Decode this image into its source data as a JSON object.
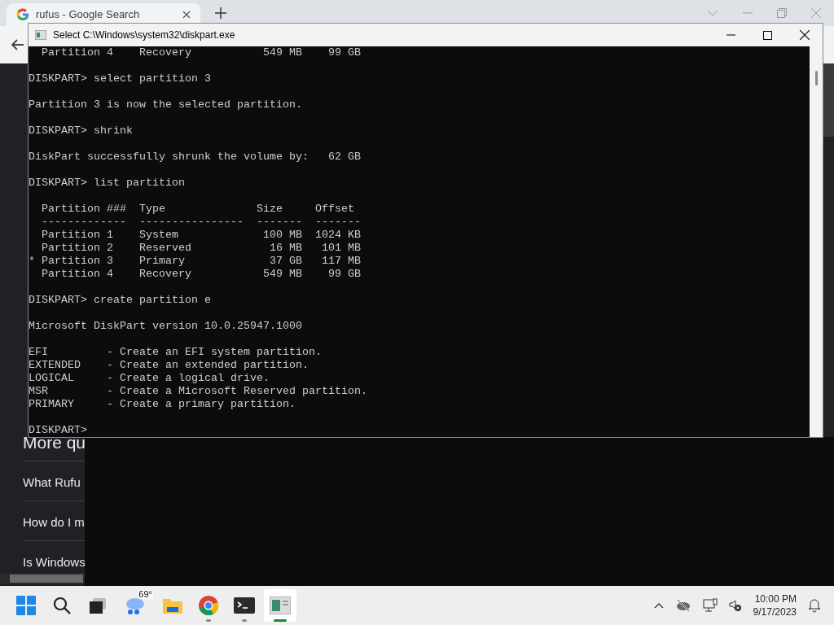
{
  "browser": {
    "tab": {
      "title": "rufus - Google Search",
      "selected": true
    },
    "more_questions": {
      "heading": "More qu",
      "items": [
        "What Rufu",
        "How do I m",
        "Is Windows"
      ]
    }
  },
  "console": {
    "title": "Select C:\\Windows\\system32\\diskpart.exe",
    "blocks": [
      [
        "  Partition 4    Recovery           549 MB    99 GB"
      ],
      [
        "DISKPART> select partition 3"
      ],
      [
        "Partition 3 is now the selected partition."
      ],
      [
        "DISKPART> shrink"
      ],
      [
        "DiskPart successfully shrunk the volume by:   62 GB"
      ],
      [
        "DISKPART> list partition"
      ],
      [
        "  Partition ###  Type              Size     Offset",
        "  -------------  ----------------  -------  -------",
        "  Partition 1    System             100 MB  1024 KB",
        "  Partition 2    Reserved            16 MB   101 MB",
        "* Partition 3    Primary             37 GB   117 MB",
        "  Partition 4    Recovery           549 MB    99 GB"
      ],
      [
        "DISKPART> create partition e"
      ],
      [
        "Microsoft DiskPart version 10.0.25947.1000"
      ],
      [
        "EFI         - Create an EFI system partition.",
        "EXTENDED    - Create an extended partition.",
        "LOGICAL     - Create a logical drive.",
        "MSR         - Create a Microsoft Reserved partition.",
        "PRIMARY     - Create a primary partition."
      ],
      [
        "DISKPART>"
      ]
    ]
  },
  "taskbar": {
    "apps": [
      {
        "kind": "start"
      },
      {
        "kind": "search"
      },
      {
        "kind": "taskview"
      },
      {
        "kind": "weather",
        "text": "69°"
      },
      {
        "kind": "folder"
      },
      {
        "kind": "chrome",
        "running": true,
        "active": false
      },
      {
        "kind": "terminal",
        "running": true,
        "active": false
      },
      {
        "kind": "diskapp",
        "running": true,
        "active": true
      }
    ],
    "time": "10:00 PM",
    "date": "9/17/2023"
  }
}
